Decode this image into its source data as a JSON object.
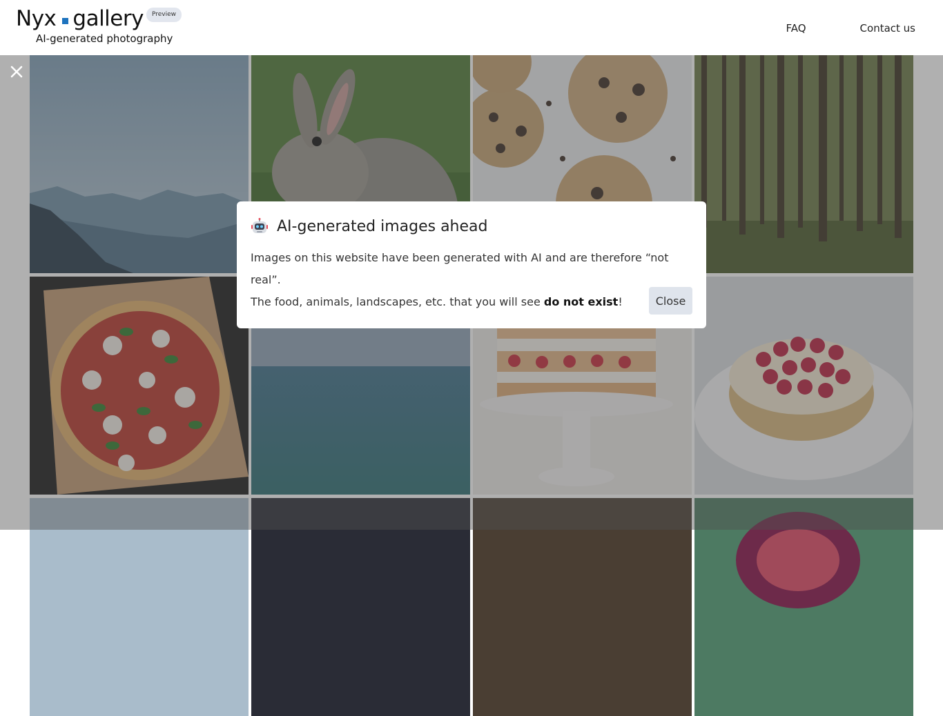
{
  "header": {
    "logo_left": "Nyx",
    "logo_right": "gallery",
    "badge": "Preview",
    "tagline": "AI-generated photography",
    "nav": {
      "faq": "FAQ",
      "contact": "Contact us"
    }
  },
  "modal": {
    "title": "AI-generated images ahead",
    "line1": "Images on this website have been generated with AI and are therefore “not real”.",
    "line2_prefix": "The food, animals, landscapes, etc. that you will see ",
    "line2_bold": "do not exist",
    "line2_suffix": "!",
    "close_label": "Close"
  },
  "gallery": {
    "tiles": [
      {
        "subject": "mountain landscape"
      },
      {
        "subject": "rabbit"
      },
      {
        "subject": "chocolate chip cookies"
      },
      {
        "subject": "pine forest"
      },
      {
        "subject": "margherita pizza"
      },
      {
        "subject": "ocean"
      },
      {
        "subject": "layered strawberry cake"
      },
      {
        "subject": "raspberry tart"
      },
      {
        "subject": "cloudy sky"
      },
      {
        "subject": "night sky"
      },
      {
        "subject": "dark still life"
      },
      {
        "subject": "fig"
      }
    ]
  },
  "colors": {
    "accent": "#1e73be",
    "button_bg": "#dfe4ec"
  },
  "icons": {
    "overlay_close": "close-icon",
    "modal_emoji": "robot-icon"
  }
}
